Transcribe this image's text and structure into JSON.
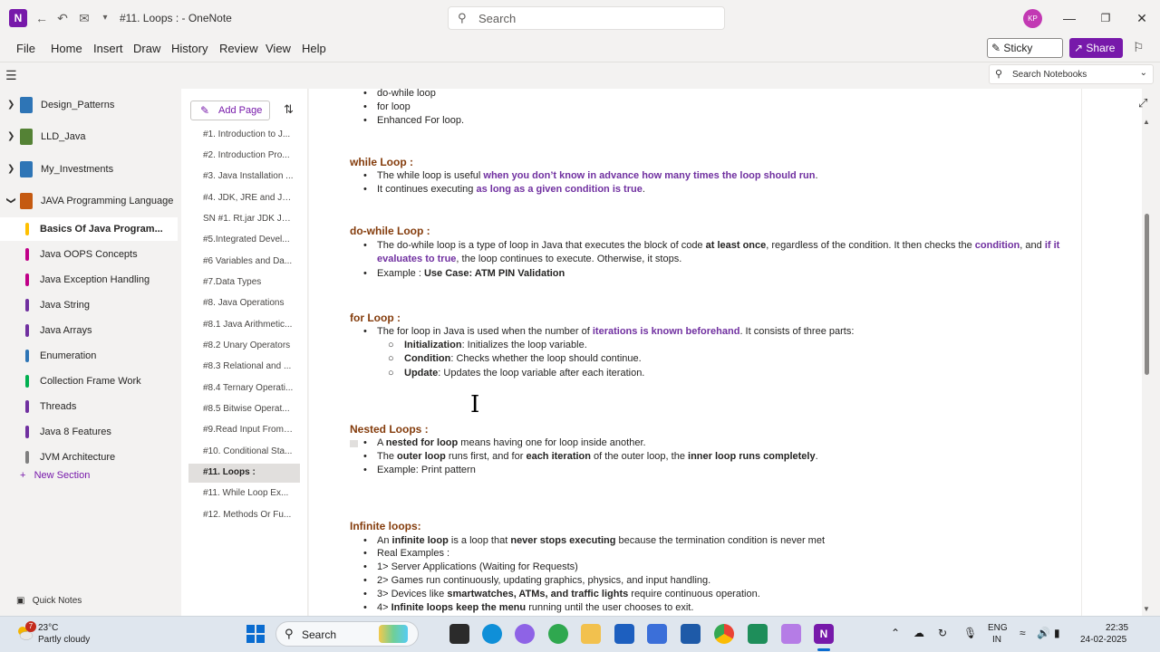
{
  "titlebar": {
    "app_logo": "N",
    "back_icon": "←",
    "undo_icon": "↶",
    "title": "#11. Loops : - OneNote",
    "search_placeholder": "Search",
    "avatar": "KP"
  },
  "menu": {
    "items": [
      "File",
      "Home",
      "Insert",
      "Draw",
      "History",
      "Review",
      "View",
      "Help"
    ],
    "sticky_notes": "Sticky Notes",
    "share": "Share"
  },
  "notebook_search": {
    "placeholder": "Search Notebooks"
  },
  "notebooks": [
    {
      "label": "Design_Patterns",
      "color": "#2e75b6"
    },
    {
      "label": "LLD_Java",
      "color": "#548235"
    },
    {
      "label": "My_Investments",
      "color": "#2e75b6"
    },
    {
      "label": "JAVA Programming Language",
      "color": "#c55a11"
    }
  ],
  "sections": [
    {
      "label": "Basics Of Java Program...",
      "color": "#ffc000",
      "active": true
    },
    {
      "label": "Java OOPS Concepts",
      "color": "#c00088"
    },
    {
      "label": "Java Exception Handling",
      "color": "#c00088"
    },
    {
      "label": "Java String",
      "color": "#7030a0"
    },
    {
      "label": "Java Arrays",
      "color": "#7030a0"
    },
    {
      "label": "Enumeration",
      "color": "#2e75b6"
    },
    {
      "label": "Collection Frame Work",
      "color": "#00b050"
    },
    {
      "label": "Threads",
      "color": "#7030a0"
    },
    {
      "label": "Java 8 Features",
      "color": "#7030a0"
    },
    {
      "label": "JVM Architecture",
      "color": "#7f7f7f"
    }
  ],
  "new_section": "New Section",
  "quick_notes": "Quick Notes",
  "pages_panel": {
    "add_page": "Add Page",
    "pages": [
      "#1. Introduction to J...",
      "#2. Introduction Pro...",
      "#3. Java Installation ...",
      "#4. JDK, JRE and JVM",
      "SN #1. Rt.jar JDK JR...",
      "#5.Integrated Devel...",
      "#6 Variables and Da...",
      "#7.Data Types",
      "#8. Java Operations",
      "#8.1 Java Arithmetic...",
      "#8.2 Unary Operators",
      "#8.3 Relational and ...",
      "#8.4 Ternary Operati...",
      "#8.5 Bitwise Operat...",
      "#9.Read Input From ...",
      "#10. Conditional Sta...",
      "#11. Loops :",
      "#11. While Loop Ex...",
      "#12. Methods Or Fu..."
    ],
    "active_index": 16
  },
  "content": {
    "intro_list": [
      "do-while loop",
      "for loop",
      "Enhanced For loop."
    ],
    "while_heading": "while Loop :",
    "while_b1_pre": "The while loop is useful ",
    "while_b1_hl": "when you don’t know in advance how many times the loop should run",
    "while_b1_post": ".",
    "while_b2_pre": "It continues executing ",
    "while_b2_hl": "as long as a given condition is true",
    "while_b2_post": ".",
    "dowhile_heading": "do-while Loop :",
    "dw_b1_a": "The do-while loop is a type of loop in Java that executes the block of code ",
    "dw_b1_b": "at least once",
    "dw_b1_c": ", regardless of the condition. It then checks the ",
    "dw_b1_d": "condition",
    "dw_b1_e": ", and ",
    "dw_b1_f": "if it",
    "dw_b1_g": "evaluates to true",
    "dw_b1_h": ", the loop continues to execute. Otherwise, it stops.",
    "dw_b2_pre": "Example : ",
    "dw_b2_bold": "Use Case: ATM PIN Validation",
    "for_heading": "for Loop :",
    "for_b1_pre": "The for loop in Java is used when the number of ",
    "for_b1_hl": "iterations is known beforehand",
    "for_b1_post": ". It consists of three parts:",
    "for_sub1_bold": "Initialization",
    "for_sub1_text": ": Initializes the loop variable.",
    "for_sub2_bold": "Condition",
    "for_sub2_text": ": Checks whether the loop should continue.",
    "for_sub3_bold": "Update",
    "for_sub3_text": ": Updates the loop variable after each iteration.",
    "nested_heading": "Nested Loops :",
    "n_b1_a": "A ",
    "n_b1_b": "nested for loop",
    "n_b1_c": " means having one for loop inside another.",
    "n_b2_a": "The ",
    "n_b2_b": "outer loop",
    "n_b2_c": " runs first, and for ",
    "n_b2_d": "each iteration",
    "n_b2_e": " of the outer loop, the ",
    "n_b2_f": "inner loop runs completely",
    "n_b2_g": ".",
    "n_b3": "Example:  Print pattern",
    "inf_heading": "Infinite loops:",
    "i_b1_a": "An ",
    "i_b1_b": "infinite loop",
    "i_b1_c": " is a loop that ",
    "i_b1_d": "never stops executing",
    "i_b1_e": " because the termination condition is never met",
    "i_b2": "Real Examples :",
    "i_b3": "1> Server Applications (Waiting for Requests)",
    "i_b4": "2> Games run continuously, updating graphics, physics, and input handling.",
    "i_b5_a": "3> Devices like ",
    "i_b5_b": "smartwatches, ATMs, and traffic lights",
    "i_b5_c": " require continuous operation.",
    "i_b6_a": "4> ",
    "i_b6_b": "Infinite loops keep the menu",
    "i_b6_c": " running until the user chooses to exit."
  },
  "taskbar": {
    "weather_badge": "7",
    "temperature": "23°C",
    "weather": "Partly cloudy",
    "search": "Search",
    "lang1": "ENG",
    "lang2": "IN",
    "time": "22:35",
    "date": "24-02-2025"
  }
}
